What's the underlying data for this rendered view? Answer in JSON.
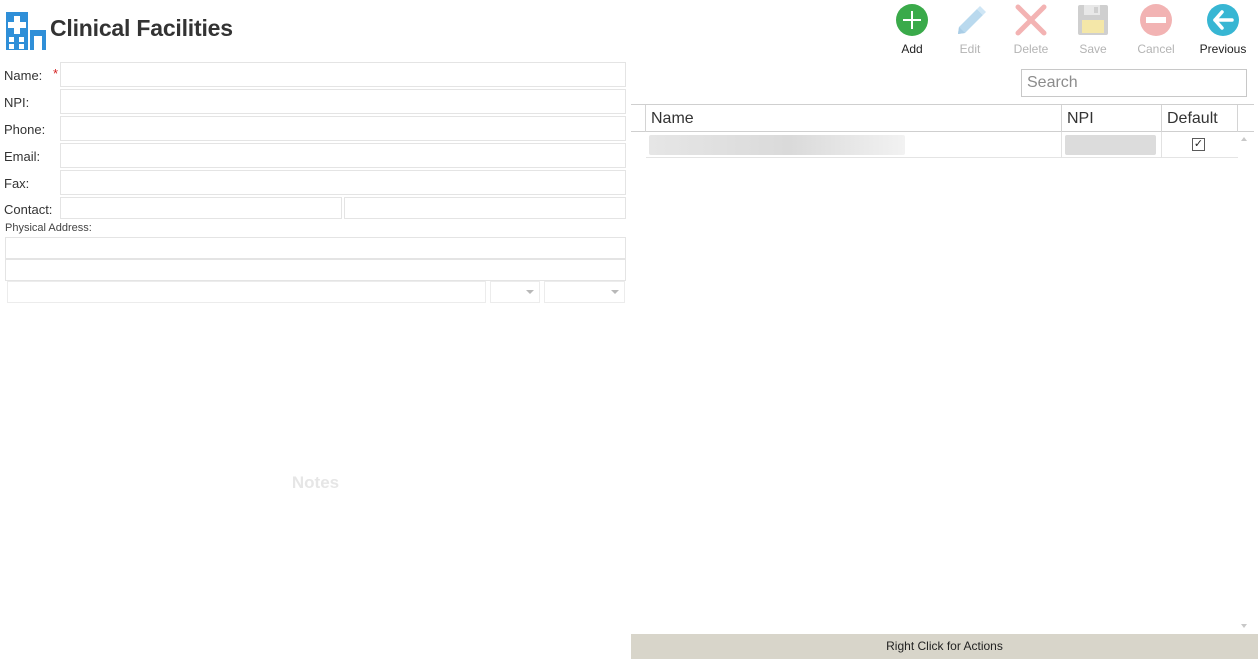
{
  "header": {
    "title": "Clinical Facilities",
    "icon": "hospital-building-icon"
  },
  "toolbar": {
    "add": {
      "label": "Add",
      "icon": "plus-circle-icon",
      "enabled": true,
      "color": "#3aaa4a"
    },
    "edit": {
      "label": "Edit",
      "icon": "pencil-icon",
      "enabled": false,
      "color": "#b9d9ee"
    },
    "delete": {
      "label": "Delete",
      "icon": "x-icon",
      "enabled": false,
      "color": "#f3b3b3"
    },
    "save": {
      "label": "Save",
      "icon": "floppy-disk-icon",
      "enabled": false,
      "color": "#cfcfcf"
    },
    "cancel": {
      "label": "Cancel",
      "icon": "minus-circle-icon",
      "enabled": false,
      "color": "#f2b3b3"
    },
    "previous": {
      "label": "Previous",
      "icon": "arrow-left-circle-icon",
      "enabled": true,
      "color": "#37b6d3"
    }
  },
  "form": {
    "name_label": "Name:",
    "required_marker": "*",
    "npi_label": "NPI:",
    "phone_label": "Phone:",
    "email_label": "Email:",
    "fax_label": "Fax:",
    "contact_label": "Contact:",
    "physical_address_label": "Physical Address:",
    "notes_placeholder": "Notes",
    "values": {
      "name": "",
      "npi": "",
      "phone": "",
      "email": "",
      "fax": "",
      "contact_first": "",
      "contact_last": "",
      "address_line1": "",
      "address_line2": "",
      "city": "",
      "state": "",
      "zip": ""
    }
  },
  "list": {
    "search_placeholder": "Search",
    "columns": [
      "Name",
      "NPI",
      "Default"
    ],
    "rows": [
      {
        "name_redacted": true,
        "npi_redacted": true,
        "default_checked": true
      }
    ],
    "checkmark": "✓"
  },
  "status_bar": {
    "text": "Right Click for Actions"
  },
  "colors": {
    "accent_blue": "#2f8fd8",
    "status_bar_bg": "#d8d5ca",
    "required_red": "#d42020"
  }
}
